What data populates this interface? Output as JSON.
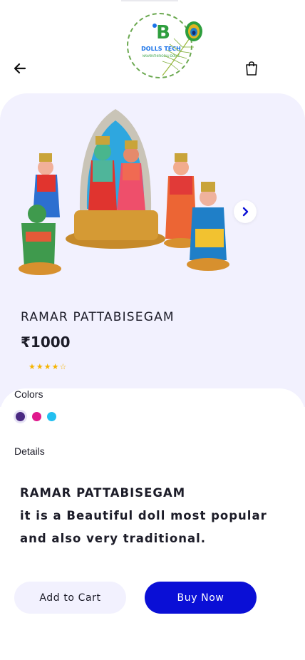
{
  "brand": {
    "logo_letter": "B",
    "logo_name": "DOLLS TECH",
    "logo_tagline": "NAVARATHIRIGOLU DOLLS"
  },
  "header": {
    "back_icon": "arrow-left-icon",
    "cart_icon": "shopping-bag-icon"
  },
  "product": {
    "title": "RAMAR PATTABISEGAM",
    "price": "₹1000",
    "rating": 4,
    "rating_max": 5,
    "image_icon": "next-chevron-icon"
  },
  "colors": {
    "label": "Colors",
    "options": [
      {
        "name": "purple",
        "hex": "#4a2a82",
        "selected": true
      },
      {
        "name": "pink",
        "hex": "#e0198c",
        "selected": false
      },
      {
        "name": "sky",
        "hex": "#23bff0",
        "selected": false
      }
    ]
  },
  "details": {
    "label": "Details",
    "text": "RAMAR PATTABISEGAM\n    it is a Beautiful doll most popular and also very traditional."
  },
  "actions": {
    "add_to_cart": "Add to Cart",
    "buy_now": "Buy Now"
  },
  "theme": {
    "accent": "#0a0fd6",
    "panel": "#f2f1fe",
    "star": "#f5b400"
  }
}
